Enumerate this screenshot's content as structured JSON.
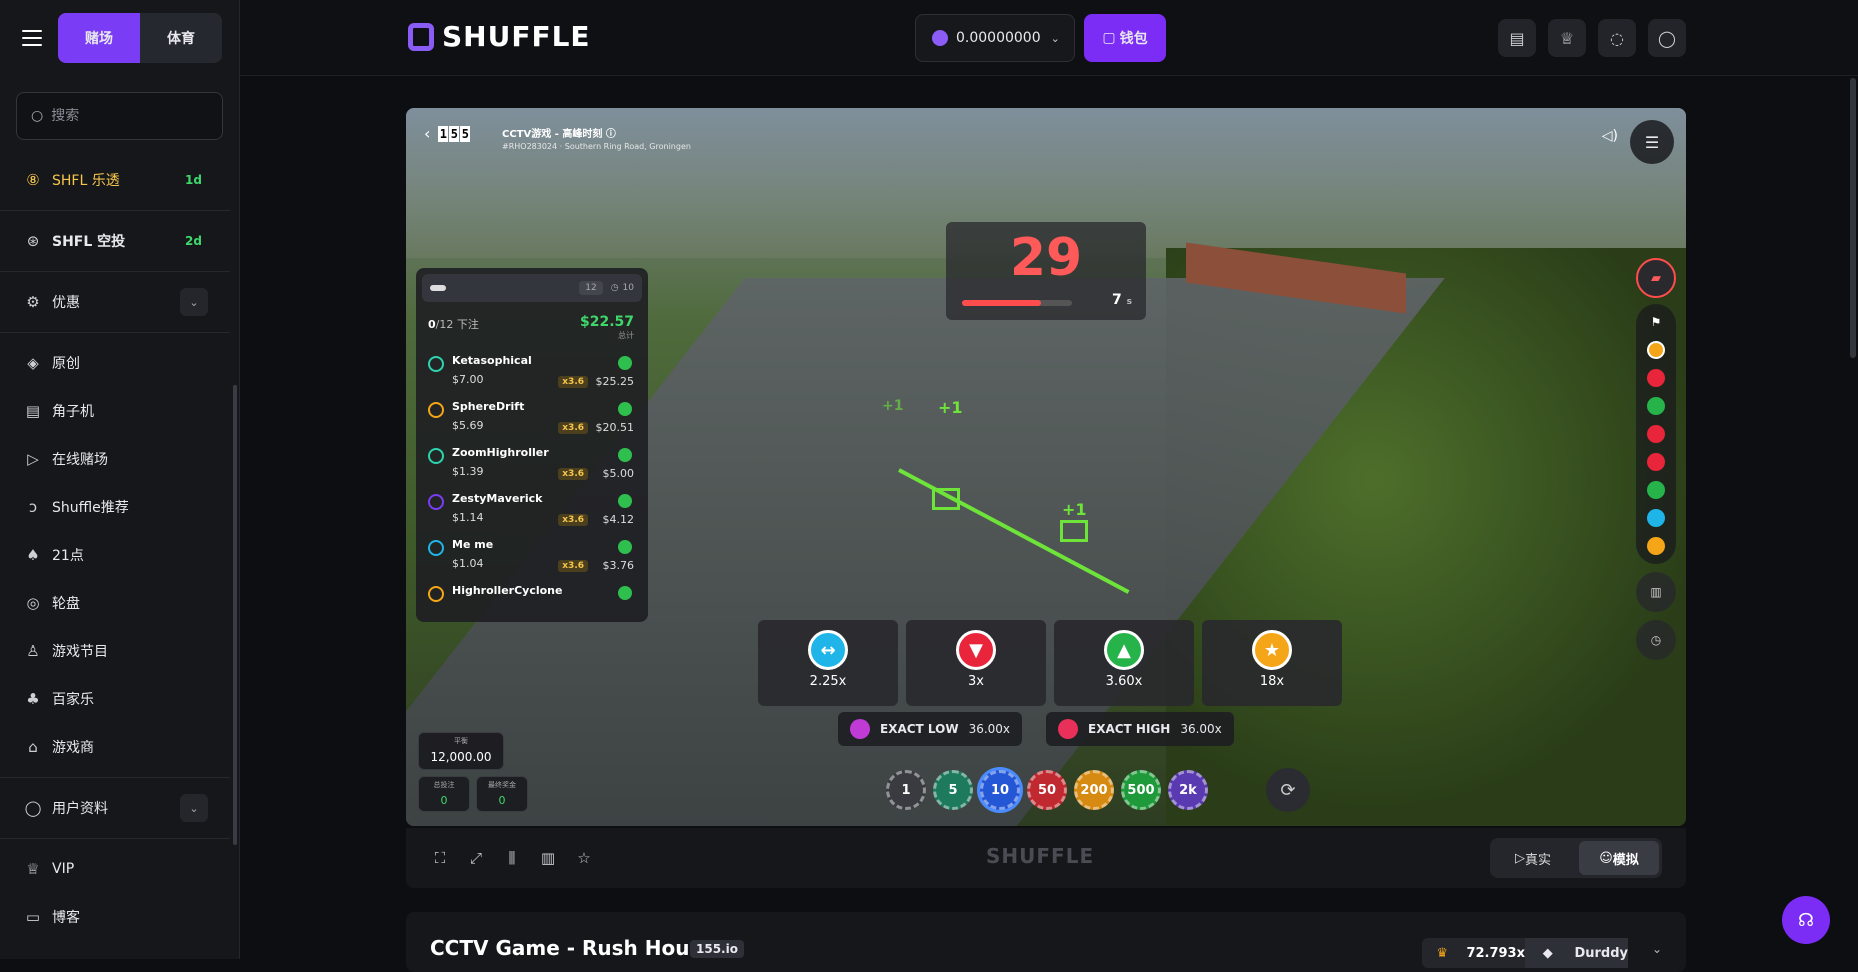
{
  "sidebar": {
    "tabs": [
      {
        "label": "赌场"
      },
      {
        "label": "体育"
      }
    ],
    "search_placeholder": "搜索",
    "promo_items": [
      {
        "label": "SHFL 乐透",
        "tag": "1d"
      },
      {
        "label": "SHFL 空投",
        "tag": "2d"
      }
    ],
    "offers_label": "优惠",
    "games": [
      {
        "label": "原创"
      },
      {
        "label": "角子机"
      },
      {
        "label": "在线赌场"
      },
      {
        "label": "Shuffle推荐"
      },
      {
        "label": "21点"
      },
      {
        "label": "轮盘"
      },
      {
        "label": "游戏节目"
      },
      {
        "label": "百家乐"
      },
      {
        "label": "游戏商"
      }
    ],
    "profile_label": "用户资料",
    "vip_label": "VIP",
    "blog_label": "博客"
  },
  "header": {
    "logo": "SHUFFLE",
    "balance": "0.00000000",
    "wallet_label": "钱包"
  },
  "game": {
    "counter": [
      "1",
      "5",
      "5"
    ],
    "cam_title": "CCTV游戏 - 高峰时刻",
    "cam_sub": "#RHO283024 · Southern Ring Road, Groningen",
    "timer": {
      "value": "29",
      "seconds": "7",
      "seconds_unit": "s",
      "progress": 0.72
    },
    "plus_label": "+1",
    "bets": {
      "count_label": "12",
      "count_label2": "10",
      "placed": "0",
      "placed_total": "/12 下注",
      "total": "$22.57",
      "total_label": "总计",
      "rows": [
        {
          "name": "Ketasophical",
          "amount": "$7.00",
          "mult": "x3.6",
          "win": "$25.25"
        },
        {
          "name": "SphereDrift",
          "amount": "$5.69",
          "mult": "x3.6",
          "win": "$20.51"
        },
        {
          "name": "ZoomHighroller",
          "amount": "$1.39",
          "mult": "x3.6",
          "win": "$5.00"
        },
        {
          "name": "ZestyMaverick",
          "amount": "$1.14",
          "mult": "x3.6",
          "win": "$4.12"
        },
        {
          "name": "Me me",
          "amount": "$1.04",
          "mult": "x3.6",
          "win": "$3.76"
        },
        {
          "name": "HighrollerCyclone",
          "amount": "",
          "mult": "",
          "win": ""
        }
      ]
    },
    "options": [
      {
        "value": "2.25x",
        "color": "#1fb5e8",
        "glyph": "↔"
      },
      {
        "value": "3x",
        "color": "#e8253b",
        "glyph": "▼"
      },
      {
        "value": "3.60x",
        "color": "#26b44a",
        "glyph": "▲"
      },
      {
        "value": "18x",
        "color": "#f5a518",
        "glyph": "★"
      }
    ],
    "exact_low": {
      "label": "EXACT LOW",
      "value": "36.00x"
    },
    "exact_high": {
      "label": "EXACT HIGH",
      "value": "36.00x"
    },
    "chips": [
      "1",
      "5",
      "10",
      "50",
      "200",
      "500",
      "2k"
    ],
    "balance_label": "平衡",
    "balance_value": "12,000.00",
    "total_bet_label": "总投注",
    "total_bet_value": "0",
    "total_win_label": "最终奖金",
    "total_win_value": "0"
  },
  "game_bar": {
    "logo": "SHUFFLE",
    "mode_real": "真实",
    "mode_demo": "模拟"
  },
  "info": {
    "title": "CCTV Game - Rush Hour",
    "provider": "155.io",
    "record_mult": "72.793x",
    "record_user": "Durddy"
  }
}
